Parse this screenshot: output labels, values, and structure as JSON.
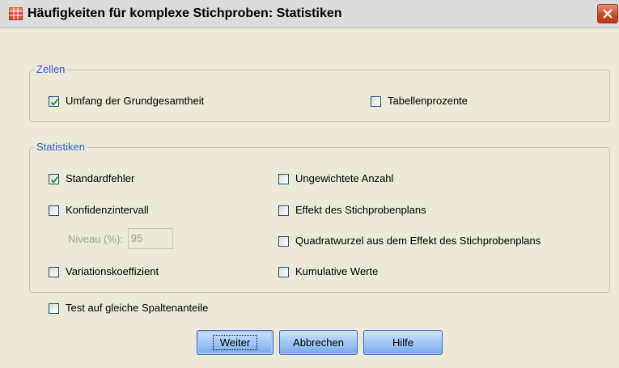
{
  "window": {
    "title": "Häufigkeiten für komplexe Stichproben: Statistiken"
  },
  "zellen": {
    "legend": "Zellen",
    "umfang": {
      "label": "Umfang der Grundgesamtheit",
      "checked": true
    },
    "tabellenprozente": {
      "label": "Tabellenprozente",
      "checked": false
    }
  },
  "statistiken": {
    "legend": "Statistiken",
    "standardfehler": {
      "label": "Standardfehler",
      "checked": true
    },
    "konfidenzintervall": {
      "label": "Konfidenzintervall",
      "checked": false
    },
    "niveau": {
      "label": "Niveau (%):",
      "value": "95",
      "enabled": false
    },
    "variationskoeffizient": {
      "label": "Variationskoeffizient",
      "checked": false
    },
    "ungewichtete_anzahl": {
      "label": "Ungewichtete Anzahl",
      "checked": false
    },
    "effekt": {
      "label": "Effekt des Stichprobenplans",
      "checked": false
    },
    "quadratwurzel": {
      "label": "Quadratwurzel aus dem Effekt des Stichprobenplans",
      "checked": false
    },
    "kumulative": {
      "label": "Kumulative Werte",
      "checked": false
    }
  },
  "test_gleiche": {
    "label": "Test auf gleiche Spaltenanteile",
    "checked": false
  },
  "buttons": {
    "weiter": "Weiter",
    "abbrechen": "Abbrechen",
    "hilfe": "Hilfe"
  },
  "icons": {
    "title": "table-icon",
    "close": "close-icon",
    "check": "checkmark-icon"
  },
  "colors": {
    "group_title": "#2e5ed8",
    "close_button": "#cc4a26",
    "button_blue": "#9cc4f5"
  }
}
